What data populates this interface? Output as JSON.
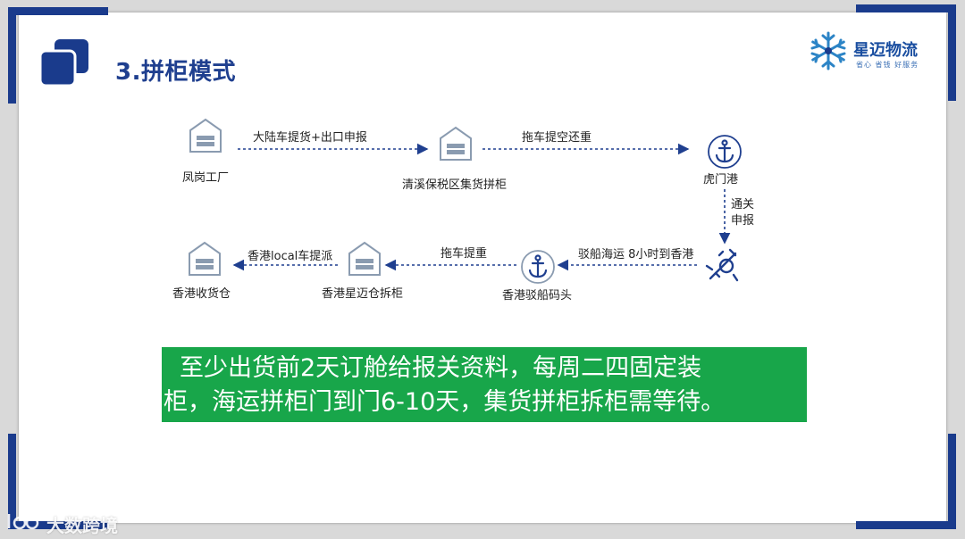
{
  "title": "3.拼柜模式",
  "logo": {
    "name": "星迈物流",
    "tagline": "省心  省钱  好服务",
    "icon": "snowflake-logo-icon"
  },
  "nodes": [
    {
      "id": "fenggang",
      "label": "凤岗工厂",
      "icon": "warehouse-icon"
    },
    {
      "id": "qingxi",
      "label": "清溪保税区集货拼柜",
      "icon": "warehouse-icon"
    },
    {
      "id": "humen",
      "label": "虎门港",
      "icon": "anchor-icon"
    },
    {
      "id": "ship",
      "label": "",
      "icon": "ship-anchor-icon"
    },
    {
      "id": "hk_barge",
      "label": "香港驳船码头",
      "icon": "anchor-icon"
    },
    {
      "id": "hk_xingmai",
      "label": "香港星迈仓拆柜",
      "icon": "warehouse-icon"
    },
    {
      "id": "hk_receive",
      "label": "香港收货仓",
      "icon": "warehouse-icon"
    }
  ],
  "edges": [
    {
      "from": "fenggang",
      "to": "qingxi",
      "label": "大陆车提货+出口申报"
    },
    {
      "from": "qingxi",
      "to": "humen",
      "label": "拖车提空还重"
    },
    {
      "from": "humen",
      "to": "ship",
      "label_line1": "通关",
      "label_line2": "申报"
    },
    {
      "from": "ship",
      "to": "hk_barge",
      "label": "驳船海运 8小时到香港"
    },
    {
      "from": "hk_barge",
      "to": "hk_xingmai",
      "label": "拖车提重"
    },
    {
      "from": "hk_xingmai",
      "to": "hk_receive",
      "label": "香港local车提派"
    }
  ],
  "note": {
    "line1": "至少出货前2天订舱给报关资料，每周二四固定装",
    "line2": "柜，海运拼柜门到门6-10天，集货拼柜拆柜需等待。",
    "bg_color": "#18a64a"
  },
  "watermark": "大数跨境",
  "colors": {
    "accent": "#1f3f8f",
    "corner": "#1a3b8c",
    "icon": "#8a9bb0"
  }
}
